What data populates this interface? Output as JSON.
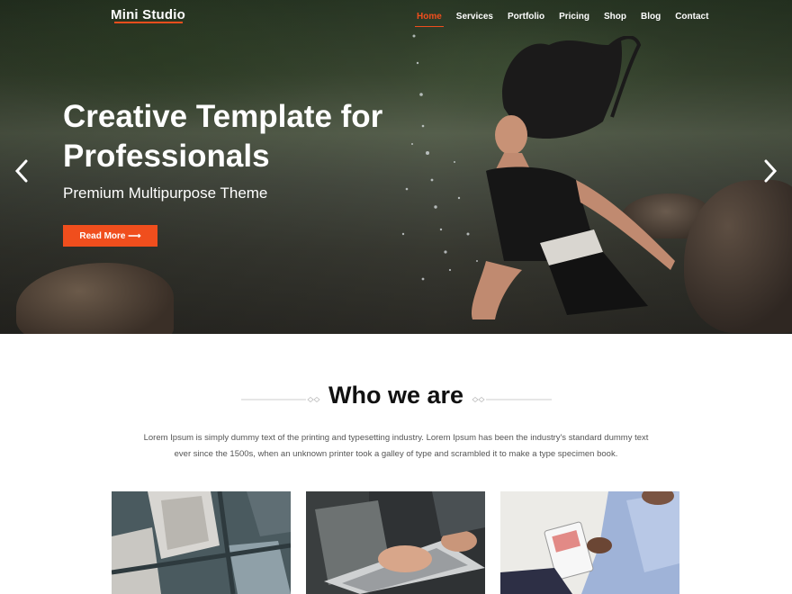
{
  "brand": {
    "name": "Mini Studio"
  },
  "nav": {
    "items": [
      {
        "label": "Home",
        "active": true
      },
      {
        "label": "Services",
        "active": false
      },
      {
        "label": "Portfolio",
        "active": false
      },
      {
        "label": "Pricing",
        "active": false
      },
      {
        "label": "Shop",
        "active": false
      },
      {
        "label": "Blog",
        "active": false
      },
      {
        "label": "Contact",
        "active": false
      }
    ]
  },
  "hero": {
    "title": "Creative Template for Professionals",
    "subtitle": "Premium Multipurpose Theme",
    "button_label": "Read More ⟶",
    "prev_icon": "chevron-left-icon",
    "next_icon": "chevron-right-icon"
  },
  "about": {
    "title": "Who we are",
    "text": "Lorem Ipsum is simply dummy text of the printing and typesetting industry. Lorem Ipsum has been the industry's standard dummy text ever since the 1500s, when an unknown printer took a galley of type and scrambled it to make a type specimen book."
  },
  "colors": {
    "accent": "#f04e1d",
    "heading": "#111111",
    "body_text": "#555555"
  }
}
